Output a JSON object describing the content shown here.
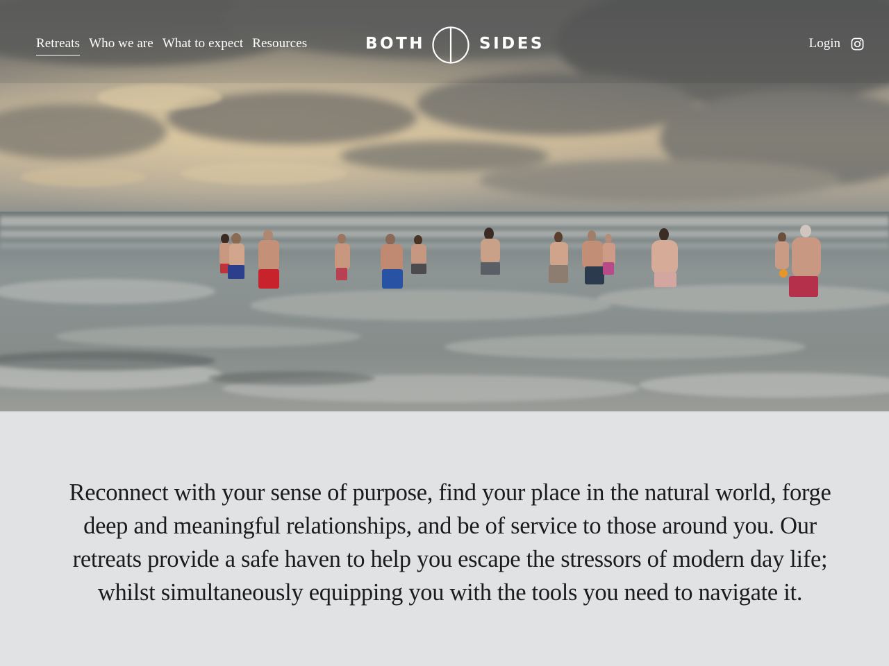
{
  "nav": {
    "items": [
      {
        "label": "Retreats",
        "active": true
      },
      {
        "label": "Who we are",
        "active": false
      },
      {
        "label": "What to expect",
        "active": false
      },
      {
        "label": "Resources",
        "active": false
      }
    ]
  },
  "logo": {
    "word_left": "BOTH",
    "word_right": "SIDES"
  },
  "header_right": {
    "login_label": "Login",
    "social_icon": "instagram-icon"
  },
  "hero": {
    "image_subject": "group of swimmers wading into the sea under a cloudy sky"
  },
  "intro": {
    "text": "Reconnect with your sense of purpose, find your place in the natural world, forge deep and meaningful relationships, and be of service to those around you. Our retreats provide a safe haven to help you escape the stressors of modern day life; whilst simultaneously equipping you with the tools you need to navigate it."
  },
  "colors": {
    "content_bg": "#e1e2e4",
    "text": "#1b1b1b",
    "nav_text": "#ffffff"
  }
}
